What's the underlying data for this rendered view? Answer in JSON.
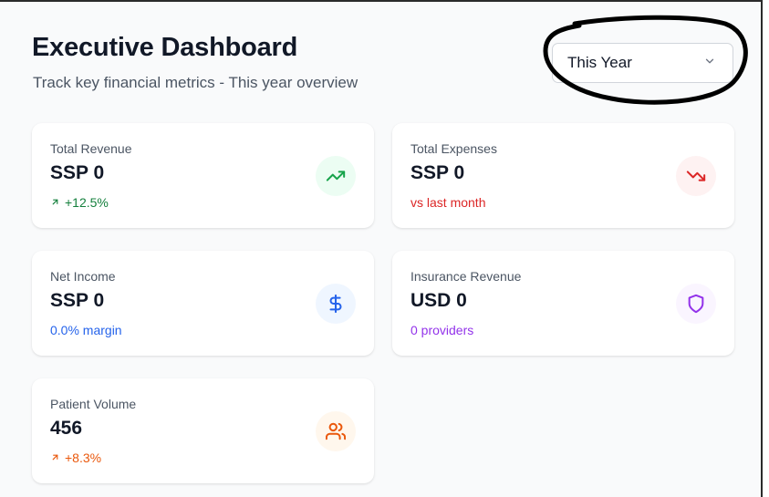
{
  "header": {
    "title": "Executive Dashboard",
    "subtitle": "Track key financial metrics - This year overview"
  },
  "period_select": {
    "selected": "This Year",
    "icon": "chevron-down-icon"
  },
  "cards": [
    {
      "label": "Total Revenue",
      "value": "SSP 0",
      "sub": "+12.5%",
      "sub_icon": "arrow-up-right-icon",
      "icon": "trending-up-icon",
      "sub_color": "#15803d",
      "icon_color": "#16a34a",
      "icon_bg": "#ecfdf3"
    },
    {
      "label": "Total Expenses",
      "value": "SSP 0",
      "sub": "vs last month",
      "icon": "trending-down-icon",
      "sub_color": "#dc2626",
      "icon_color": "#dc2626",
      "icon_bg": "#fef2f2"
    },
    {
      "label": "Net Income",
      "value": "SSP 0",
      "sub": "0.0% margin",
      "icon": "dollar-sign-icon",
      "sub_color": "#2563eb",
      "icon_color": "#2563eb",
      "icon_bg": "#eff6ff"
    },
    {
      "label": "Insurance Revenue",
      "value": "USD 0",
      "sub": "0 providers",
      "icon": "shield-icon",
      "sub_color": "#9333ea",
      "icon_color": "#9333ea",
      "icon_bg": "#faf5ff"
    },
    {
      "label": "Patient Volume",
      "value": "456",
      "sub": "+8.3%",
      "sub_icon": "arrow-up-right-icon",
      "icon": "users-icon",
      "sub_color": "#ea580c",
      "icon_color": "#ea580c",
      "icon_bg": "#fff7ed"
    }
  ]
}
